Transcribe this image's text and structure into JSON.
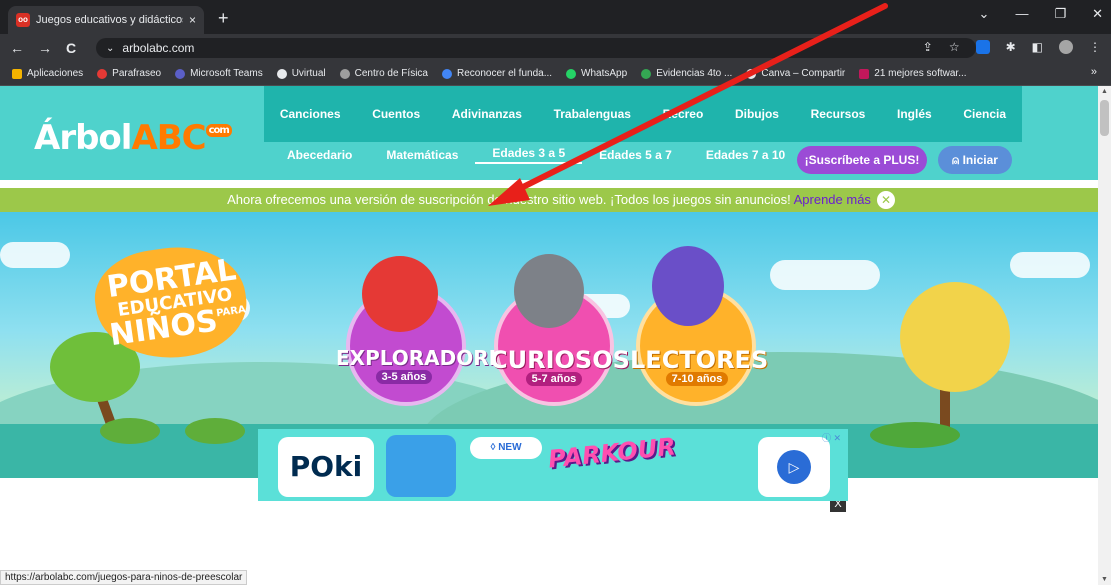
{
  "browser": {
    "tab_title": "Juegos educativos y didácticos d",
    "tab_close": "×",
    "new_tab": "+",
    "window_controls": [
      "⌄",
      "—",
      "❐",
      "✕"
    ],
    "nav_buttons": [
      "←",
      "→",
      "C"
    ],
    "address": "arbolabc.com",
    "bookmarks": [
      {
        "label": "Aplicaciones",
        "color": "#f4b400"
      },
      {
        "label": "Parafraseo",
        "color": "#e53935"
      },
      {
        "label": "Microsoft Teams",
        "color": "#5b5fc7"
      },
      {
        "label": "Uvirtual",
        "color": "#e8eaed"
      },
      {
        "label": "Centro de Física",
        "color": "#9e9e9e"
      },
      {
        "label": "Reconocer el funda...",
        "color": "#4285f4"
      },
      {
        "label": "WhatsApp",
        "color": "#25d366"
      },
      {
        "label": "Evidencias 4to ...",
        "color": "#34a853"
      },
      {
        "label": "Canva – Compartir",
        "color": "#e8eaed"
      },
      {
        "label": "21 mejores softwar...",
        "color": "#c2185b"
      }
    ],
    "bookmarks_more": "»",
    "status_url": "https://arbolabc.com/juegos-para-ninos-de-preescolar"
  },
  "site": {
    "logo_main": "Árbol",
    "logo_abc": "ABC",
    "logo_com": "com",
    "nav_primary": [
      "Canciones",
      "Cuentos",
      "Adivinanzas",
      "Trabalenguas",
      "Recreo",
      "Dibujos",
      "Recursos",
      "Inglés",
      "Ciencia"
    ],
    "nav_secondary": [
      "Abecedario",
      "Matemáticas",
      "Edades 3 a 5",
      "Edades 5 a 7",
      "Edades 7 a 10"
    ],
    "nav_secondary_active": "Edades 3 a 5",
    "plus_button": "¡Suscríbete a PLUS!",
    "login_button": "Iniciar",
    "notice_text": "Ahora ofrecemos una versión de suscripción de nuestro sitio web. ¡Todos los juegos sin anuncios!",
    "notice_link": "Aprende más",
    "hero": {
      "portal_line1": "PORTAL",
      "portal_line2": "EDUCATIVO",
      "portal_para": "PARA",
      "portal_line3": "NIÑOS",
      "medals": [
        {
          "label": "EXPLORADORES",
          "sub": "3-5 años",
          "color": "#c24bd0"
        },
        {
          "label": "CURIOSOS",
          "sub": "5-7 años",
          "color": "#f04fb0"
        },
        {
          "label": "LECTORES",
          "sub": "7-10 años",
          "color": "#ffb22a"
        }
      ]
    }
  },
  "ad": {
    "close": "X",
    "brand": "POki",
    "badge": "NEW",
    "title": "PARKOUR",
    "play_icon": "▷",
    "info": "ⓘ ✕"
  },
  "colors": {
    "header": "#4fd2cc",
    "nav_primary_bg": "#1fb4ac",
    "notice_bg": "#9cc84a",
    "arrow": "#e8201a"
  }
}
